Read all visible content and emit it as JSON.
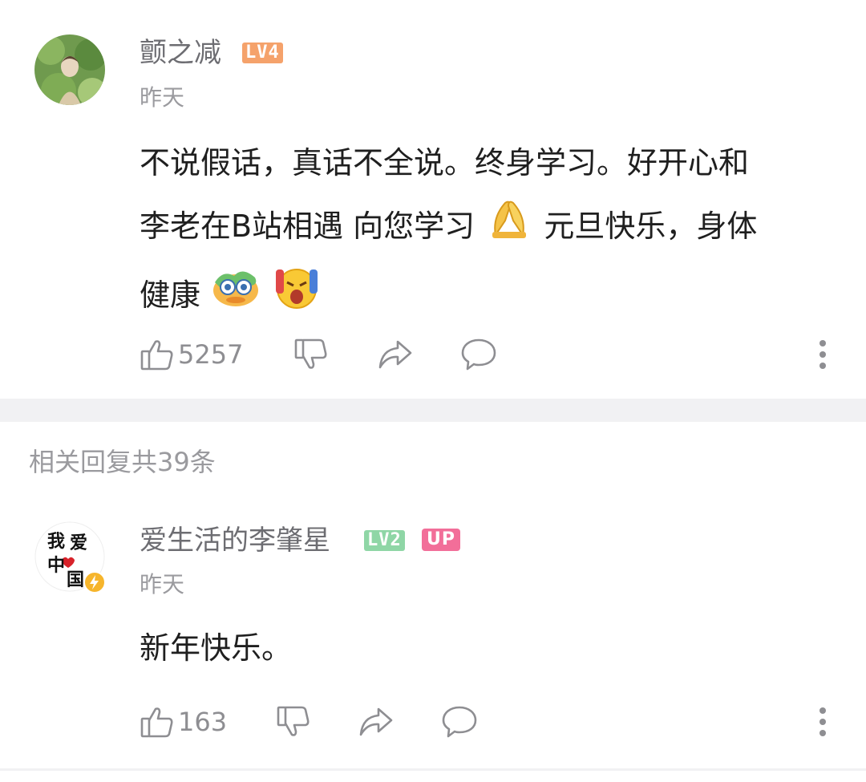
{
  "comment": {
    "username": "颤之减",
    "level": "LV4",
    "time": "昨天",
    "text_line1": "不说假话，真话不全说。终身学习。好开心和",
    "text_line2_a": "李老在B站相遇 向您学习",
    "text_line2_b": "元旦快乐，身体",
    "text_line3": "健康",
    "likes": "5257",
    "colors": {
      "level_badge": "#f5a26b"
    }
  },
  "replies_header": "相关回复共39条",
  "reply": {
    "username": "爱生活的李肇星",
    "level": "LV2",
    "up_badge": "UP",
    "time": "昨天",
    "text": "新年快乐。",
    "likes": "163",
    "avatar_text": [
      "我",
      "爱",
      "中",
      "国"
    ],
    "colors": {
      "level_badge": "#8fd6a6",
      "up_badge": "#f26e99"
    }
  },
  "icons": [
    "like-icon",
    "dislike-icon",
    "share-icon",
    "reply-icon",
    "more-icon"
  ]
}
